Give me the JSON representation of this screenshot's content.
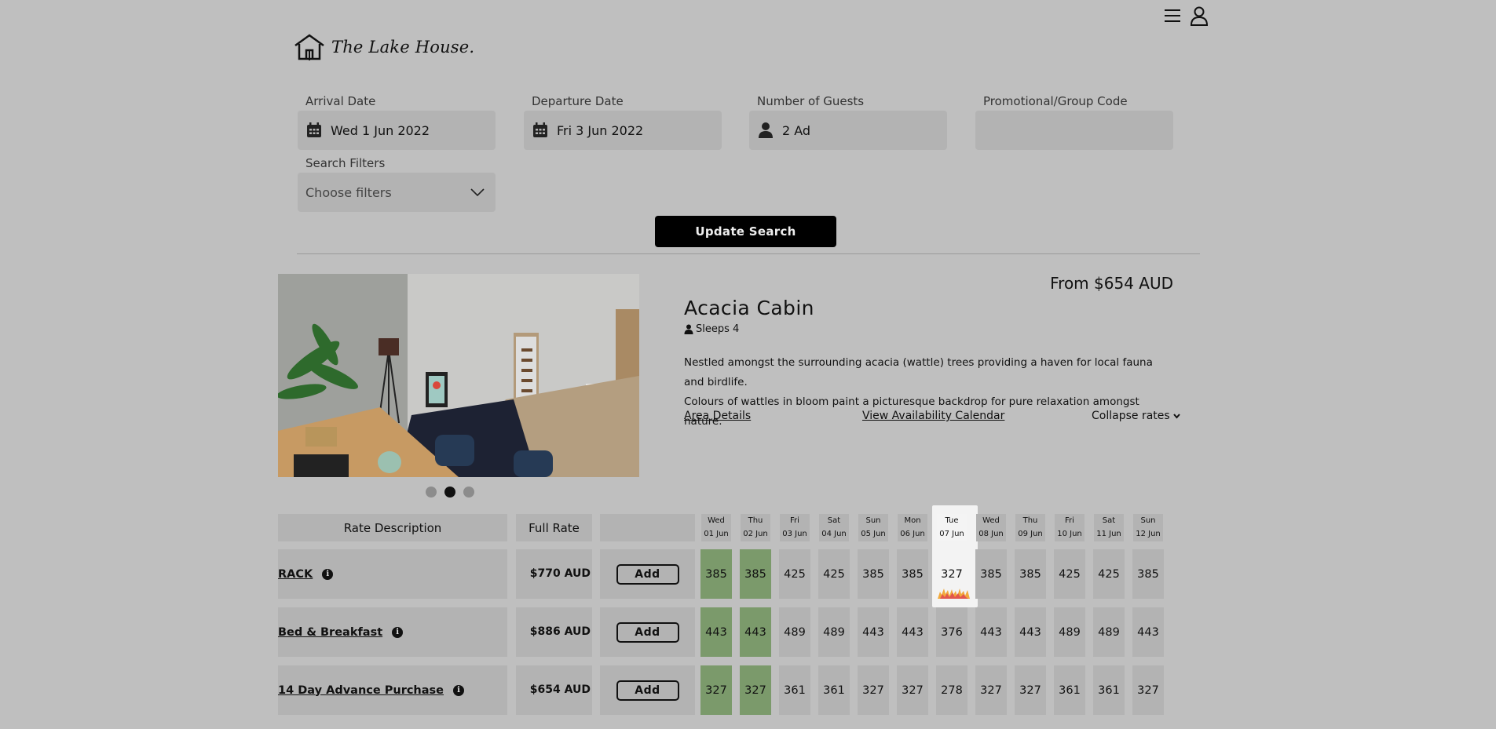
{
  "header": {
    "menu_icon": "hamburger-icon",
    "account_icon": "user-icon",
    "logo_text": "The Lake House."
  },
  "search": {
    "arrival_label": "Arrival Date",
    "arrival_value": "Wed 1 Jun 2022",
    "departure_label": "Departure Date",
    "departure_value": "Fri 3 Jun 2022",
    "guests_label": "Number of Guests",
    "guests_value": "2 Ad",
    "promo_label": "Promotional/Group Code",
    "promo_value": "",
    "filters_label": "Search Filters",
    "filters_value": "Choose filters",
    "update_button": "Update Search"
  },
  "room": {
    "from_price": "From $654 AUD",
    "title": "Acacia Cabin",
    "sleeps": "Sleeps 4",
    "description_line1": "Nestled amongst the surrounding acacia (wattle) trees providing a haven for local fauna and birdlife.",
    "description_line2": "Colours of wattles in bloom paint a picturesque backdrop for pure relaxation amongst nature.",
    "area_details": "Area Details",
    "availability_calendar": "View Availability Calendar",
    "collapse_rates": "Collapse rates",
    "carousel_dots": 3,
    "carousel_active": 2
  },
  "rates": {
    "col_description": "Rate Description",
    "col_full_rate": "Full Rate",
    "days": [
      {
        "dow": "Wed",
        "date": "01 Jun"
      },
      {
        "dow": "Thu",
        "date": "02 Jun"
      },
      {
        "dow": "Fri",
        "date": "03 Jun"
      },
      {
        "dow": "Sat",
        "date": "04 Jun"
      },
      {
        "dow": "Sun",
        "date": "05 Jun"
      },
      {
        "dow": "Mon",
        "date": "06 Jun"
      },
      {
        "dow": "Tue",
        "date": "07 Jun"
      },
      {
        "dow": "Wed",
        "date": "08 Jun"
      },
      {
        "dow": "Thu",
        "date": "09 Jun"
      },
      {
        "dow": "Fri",
        "date": "10 Jun"
      },
      {
        "dow": "Sat",
        "date": "11 Jun"
      },
      {
        "dow": "Sun",
        "date": "12 Jun"
      }
    ],
    "rows": [
      {
        "name": "RACK",
        "full_rate": "$770 AUD",
        "add_label": "Add",
        "prices": [
          "385",
          "385",
          "425",
          "425",
          "385",
          "385",
          "327",
          "385",
          "385",
          "425",
          "425",
          "385"
        ]
      },
      {
        "name": "Bed & Breakfast",
        "full_rate": "$886 AUD",
        "add_label": "Add",
        "prices": [
          "443",
          "443",
          "489",
          "489",
          "443",
          "443",
          "376",
          "443",
          "443",
          "489",
          "489",
          "443"
        ]
      },
      {
        "name": "14 Day Advance Purchase",
        "full_rate": "$654 AUD",
        "add_label": "Add",
        "prices": [
          "327",
          "327",
          "361",
          "361",
          "327",
          "327",
          "278",
          "327",
          "327",
          "361",
          "361",
          "327"
        ]
      }
    ],
    "selected_day_indices": [
      0,
      1
    ],
    "highlighted_day_index": 6,
    "selected_color": "#7b9a6b"
  }
}
